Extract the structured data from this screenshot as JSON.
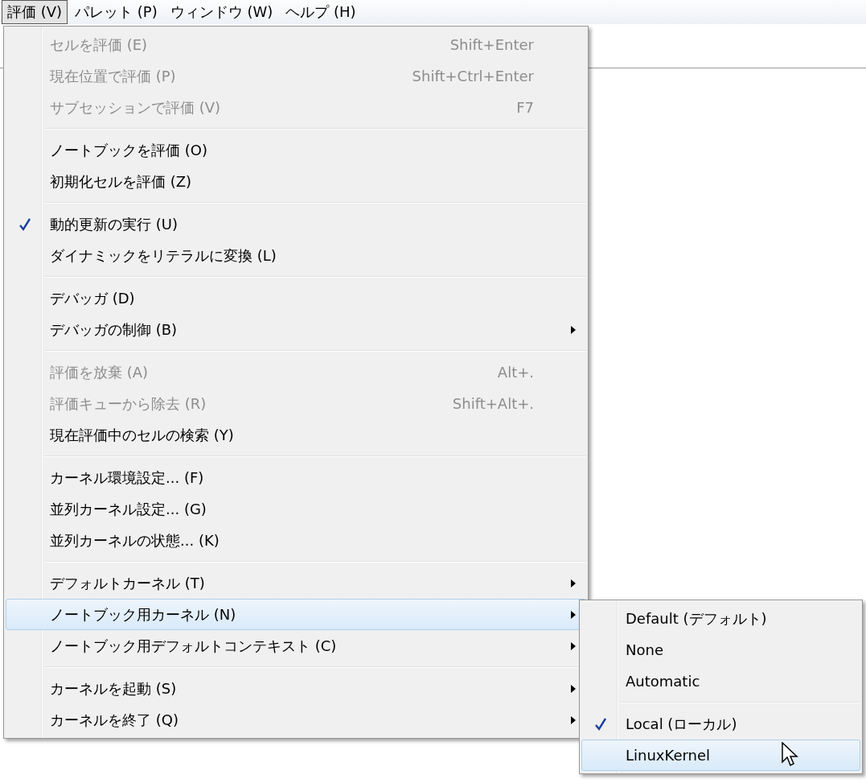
{
  "menubar": [
    {
      "label": "評価 (V)",
      "selected": true
    },
    {
      "label": "パレット (P)",
      "selected": false
    },
    {
      "label": "ウィンドウ (W)",
      "selected": false
    },
    {
      "label": "ヘルプ (H)",
      "selected": false
    }
  ],
  "menu": {
    "groups": [
      [
        {
          "label": "セルを評価 (E)",
          "shortcut": "Shift+Enter",
          "disabled": true,
          "checked": false,
          "submenu": false,
          "selected": false
        },
        {
          "label": "現在位置で評価 (P)",
          "shortcut": "Shift+Ctrl+Enter",
          "disabled": true,
          "checked": false,
          "submenu": false,
          "selected": false
        },
        {
          "label": "サブセッションで評価 (V)",
          "shortcut": "F7",
          "disabled": true,
          "checked": false,
          "submenu": false,
          "selected": false
        }
      ],
      [
        {
          "label": "ノートブックを評価 (O)",
          "disabled": false,
          "checked": false,
          "submenu": false,
          "selected": false
        },
        {
          "label": "初期化セルを評価 (Z)",
          "disabled": false,
          "checked": false,
          "submenu": false,
          "selected": false
        }
      ],
      [
        {
          "label": "動的更新の実行 (U)",
          "disabled": false,
          "checked": true,
          "submenu": false,
          "selected": false
        },
        {
          "label": "ダイナミックをリテラルに変換 (L)",
          "disabled": false,
          "checked": false,
          "submenu": false,
          "selected": false
        }
      ],
      [
        {
          "label": "デバッガ (D)",
          "disabled": false,
          "checked": false,
          "submenu": false,
          "selected": false
        },
        {
          "label": "デバッガの制御 (B)",
          "disabled": false,
          "checked": false,
          "submenu": true,
          "selected": false
        }
      ],
      [
        {
          "label": "評価を放棄 (A)",
          "shortcut": "Alt+.",
          "disabled": true,
          "checked": false,
          "submenu": false,
          "selected": false
        },
        {
          "label": "評価キューから除去 (R)",
          "shortcut": "Shift+Alt+.",
          "disabled": true,
          "checked": false,
          "submenu": false,
          "selected": false
        },
        {
          "label": "現在評価中のセルの検索 (Y)",
          "disabled": false,
          "checked": false,
          "submenu": false,
          "selected": false
        }
      ],
      [
        {
          "label": "カーネル環境設定... (F)",
          "disabled": false,
          "checked": false,
          "submenu": false,
          "selected": false
        },
        {
          "label": "並列カーネル設定... (G)",
          "disabled": false,
          "checked": false,
          "submenu": false,
          "selected": false
        },
        {
          "label": "並列カーネルの状態... (K)",
          "disabled": false,
          "checked": false,
          "submenu": false,
          "selected": false
        }
      ],
      [
        {
          "label": "デフォルトカーネル (T)",
          "disabled": false,
          "checked": false,
          "submenu": true,
          "selected": false
        },
        {
          "label": "ノートブック用カーネル (N)",
          "disabled": false,
          "checked": false,
          "submenu": true,
          "selected": true
        },
        {
          "label": "ノートブック用デフォルトコンテキスト (C)",
          "disabled": false,
          "checked": false,
          "submenu": true,
          "selected": false
        }
      ],
      [
        {
          "label": "カーネルを起動 (S)",
          "disabled": false,
          "checked": false,
          "submenu": true,
          "selected": false
        },
        {
          "label": "カーネルを終了 (Q)",
          "disabled": false,
          "checked": false,
          "submenu": true,
          "selected": false
        }
      ]
    ]
  },
  "submenu": {
    "groups": [
      [
        {
          "label": "Default (デフォルト)",
          "checked": false,
          "selected": false
        },
        {
          "label": "None",
          "checked": false,
          "selected": false
        },
        {
          "label": "Automatic",
          "checked": false,
          "selected": false
        }
      ],
      [
        {
          "label": "Local (ローカル)",
          "checked": true,
          "selected": false
        },
        {
          "label": "LinuxKernel",
          "checked": false,
          "selected": true
        }
      ]
    ]
  }
}
